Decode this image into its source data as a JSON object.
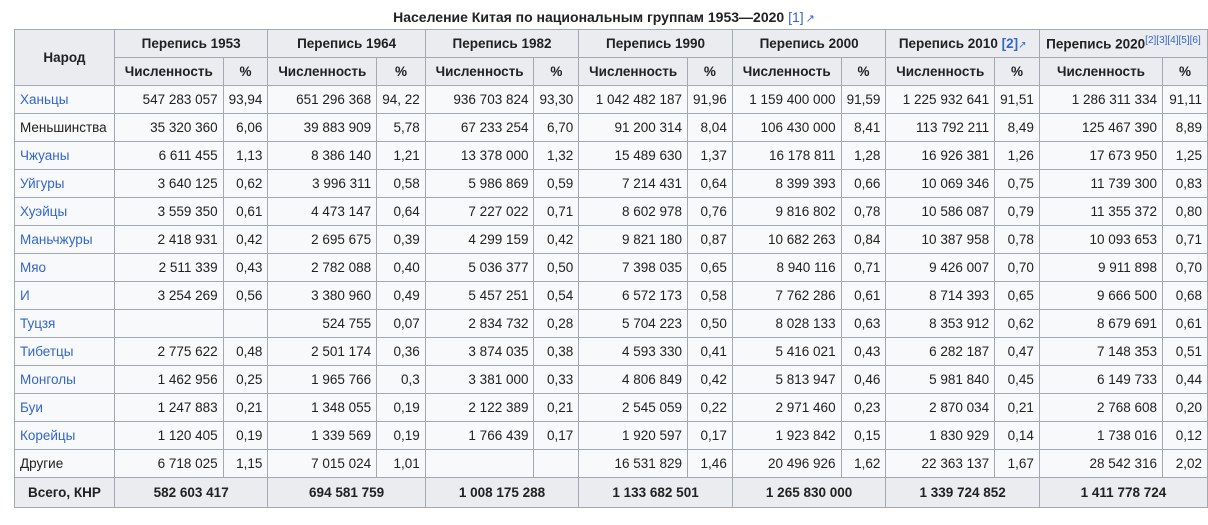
{
  "caption": {
    "text": "Население Китая по национальным группам 1953—2020",
    "ref": "[1]"
  },
  "headers": {
    "people": "Народ",
    "count": "Численность",
    "pct": "%",
    "censuses": [
      {
        "label": "Перепись 1953",
        "ref": ""
      },
      {
        "label": "Перепись 1964",
        "ref": ""
      },
      {
        "label": "Перепись 1982",
        "ref": ""
      },
      {
        "label": "Перепись 1990",
        "ref": ""
      },
      {
        "label": "Перепись 2000",
        "ref": ""
      },
      {
        "label": "Перепись 2010",
        "ref": "[2]"
      },
      {
        "label": "Перепись 2020",
        "ref": "[2][3][4][5][6]"
      }
    ]
  },
  "rows": [
    {
      "name": "Ханьцы",
      "link": true,
      "cells": [
        "547 283 057",
        "93,94",
        "651 296 368",
        "94, 22",
        "936 703 824",
        "93,30",
        "1 042 482 187",
        "91,96",
        "1 159 400 000",
        "91,59",
        "1 225 932 641",
        "91,51",
        "1 286 311 334",
        "91,11"
      ]
    },
    {
      "name": "Меньшинства",
      "link": false,
      "cells": [
        "35 320 360",
        "6,06",
        "39 883 909",
        "5,78",
        "67 233 254",
        "6,70",
        "91 200 314",
        "8,04",
        "106 430 000",
        "8,41",
        "113 792 211",
        "8,49",
        "125 467 390",
        "8,89"
      ]
    },
    {
      "name": "Чжуаны",
      "link": true,
      "cells": [
        "6 611 455",
        "1,13",
        "8 386 140",
        "1,21",
        "13 378 000",
        "1,32",
        "15 489 630",
        "1,37",
        "16 178 811",
        "1,28",
        "16 926 381",
        "1,26",
        "17 673 950",
        "1,25"
      ]
    },
    {
      "name": "Уйгуры",
      "link": true,
      "cells": [
        "3 640 125",
        "0,62",
        "3 996 311",
        "0,58",
        "5 986 869",
        "0,59",
        "7 214 431",
        "0,64",
        "8 399 393",
        "0,66",
        "10 069 346",
        "0,75",
        "11 739 300",
        "0,83"
      ]
    },
    {
      "name": "Хуэйцы",
      "link": true,
      "cells": [
        "3 559 350",
        "0,61",
        "4 473 147",
        "0,64",
        "7 227 022",
        "0,71",
        "8 602 978",
        "0,76",
        "9 816 802",
        "0,78",
        "10 586 087",
        "0,79",
        "11 355 372",
        "0,80"
      ]
    },
    {
      "name": "Маньчжуры",
      "link": true,
      "cells": [
        "2 418 931",
        "0,42",
        "2 695 675",
        "0,39",
        "4 299 159",
        "0,42",
        "9 821 180",
        "0,87",
        "10 682 263",
        "0,84",
        "10 387 958",
        "0,78",
        "10 093 653",
        "0,71"
      ]
    },
    {
      "name": "Мяо",
      "link": true,
      "cells": [
        "2 511 339",
        "0,43",
        "2 782 088",
        "0,40",
        "5 036 377",
        "0,50",
        "7 398 035",
        "0,65",
        "8 940 116",
        "0,71",
        "9 426 007",
        "0,70",
        "9 911 898",
        "0,70"
      ]
    },
    {
      "name": "И",
      "link": true,
      "cells": [
        "3 254 269",
        "0,56",
        "3 380 960",
        "0,49",
        "5 457 251",
        "0,54",
        "6 572 173",
        "0,58",
        "7 762 286",
        "0,61",
        "8 714 393",
        "0,65",
        "9 666 500",
        "0,68"
      ]
    },
    {
      "name": "Туцзя",
      "link": true,
      "cells": [
        "",
        "",
        "524 755",
        "0,07",
        "2 834 732",
        "0,28",
        "5 704 223",
        "0,50",
        "8 028 133",
        "0,63",
        "8 353 912",
        "0,62",
        "8 679 691",
        "0,61"
      ]
    },
    {
      "name": "Тибетцы",
      "link": true,
      "cells": [
        "2 775 622",
        "0,48",
        "2 501 174",
        "0,36",
        "3 874 035",
        "0,38",
        "4 593 330",
        "0,41",
        "5 416 021",
        "0,43",
        "6 282 187",
        "0,47",
        "7 148 353",
        "0,51"
      ]
    },
    {
      "name": "Монголы",
      "link": true,
      "cells": [
        "1 462 956",
        "0,25",
        "1 965 766",
        "0,3",
        "3 381 000",
        "0,33",
        "4 806 849",
        "0,42",
        "5 813 947",
        "0,46",
        "5 981 840",
        "0,45",
        "6 149 733",
        "0,44"
      ]
    },
    {
      "name": "Буи",
      "link": true,
      "cells": [
        "1 247 883",
        "0,21",
        "1 348 055",
        "0,19",
        "2 122 389",
        "0,21",
        "2 545 059",
        "0,22",
        "2 971 460",
        "0,23",
        "2 870 034",
        "0,21",
        "2 768 608",
        "0,20"
      ]
    },
    {
      "name": "Корейцы",
      "link": true,
      "cells": [
        "1 120 405",
        "0,19",
        "1 339 569",
        "0,19",
        "1 766 439",
        "0,17",
        "1 920 597",
        "0,17",
        "1 923 842",
        "0,15",
        "1 830 929",
        "0,14",
        "1 738 016",
        "0,12"
      ]
    },
    {
      "name": "Другие",
      "link": false,
      "cells": [
        "6 718 025",
        "1,15",
        "7 015 024",
        "1,01",
        "",
        "",
        "16 531 829",
        "1,46",
        "20 496 926",
        "1,62",
        "22 363 137",
        "1,67",
        "28 542 316",
        "2,02"
      ]
    }
  ],
  "total": {
    "label": "Всего, КНР",
    "values": [
      "582 603 417",
      "694 581 759",
      "1 008 175 288",
      "1 133 682 501",
      "1 265 830 000",
      "1 339 724 852",
      "1 411 778 724"
    ]
  }
}
